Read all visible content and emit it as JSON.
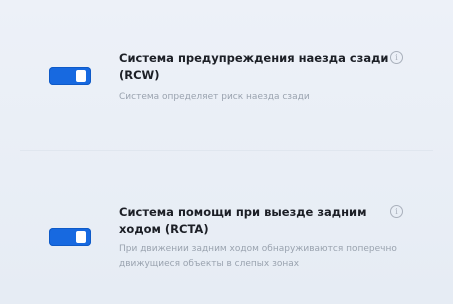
{
  "settings": {
    "rcw": {
      "title": "Система предупреждения наезда сзади (RCW)",
      "description": "Система определяет риск наезда сзади",
      "enabled": true,
      "info_icon": "info-circle-icon"
    },
    "rcta": {
      "title": "Система помощи при выезде задним ходом (RCTA)",
      "description": "При движении задним ходом обнаруживаются поперечно движущиеся объекты в слепых зонах",
      "enabled": true,
      "info_icon": "info-circle-icon"
    }
  },
  "colors": {
    "toggle_on": "#1769e0",
    "background": "#e9eef6",
    "title_text": "#1c1f26",
    "description_text": "#9aa3af"
  }
}
